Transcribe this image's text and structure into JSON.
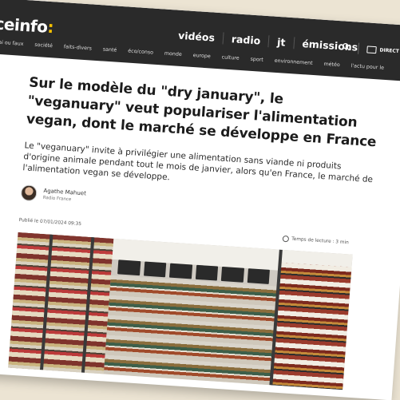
{
  "site": {
    "logo_text": "ceinfo",
    "logo_colon": ":"
  },
  "main_nav": [
    "vidéos",
    "radio",
    "jt",
    "émissions"
  ],
  "tools": {
    "direct_label": "DIRECT T"
  },
  "sub_nav": [
    "vrai ou faux",
    "société",
    "faits-divers",
    "santé",
    "éco/conso",
    "monde",
    "europe",
    "culture",
    "sport",
    "environnement",
    "météo",
    "l'actu pour le"
  ],
  "article": {
    "title": "Sur le modèle du \"dry january\", le \"veganuary\" veut populariser l'alimentation vegan, dont le marché se développe en France",
    "chapo": "Le \"veganuary\" invite à privilégier une alimentation sans viande ni produits d'origine animale pendant tout le mois de janvier, alors qu'en France, le marché de l'alimentation vegan se développe.",
    "author_name": "Agathe Mahuet",
    "author_org": "Radio France",
    "published": "Publié le 07/01/2024 09:35",
    "reading_time": "Temps de lecture : 3 min"
  },
  "colors": {
    "topbar": "#2a2a2a",
    "accent": "#f5c000"
  }
}
